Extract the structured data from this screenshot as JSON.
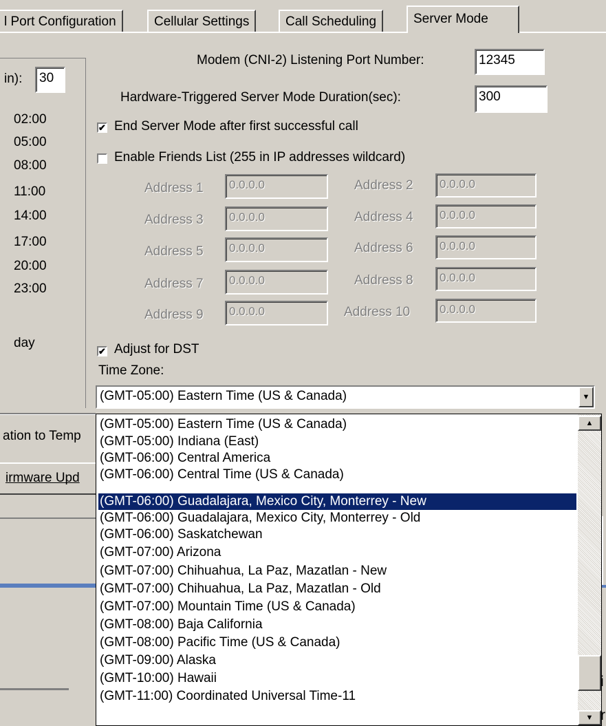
{
  "tabs": [
    {
      "label": "l Port Configuration"
    },
    {
      "label": "Cellular Settings"
    },
    {
      "label": "Call Scheduling"
    },
    {
      "label": "Server Mode"
    }
  ],
  "left_panel": {
    "interval_label": "in):",
    "interval_value": "30",
    "times": [
      "02:00",
      "05:00",
      "08:00",
      "11:00",
      "14:00",
      "17:00",
      "20:00",
      "23:00"
    ],
    "day_label": "day",
    "bottom_labels": [
      "ation to Temp",
      "irmware Upd"
    ]
  },
  "server_mode": {
    "listening_port_label": "Modem (CNI-2) Listening Port Number:",
    "listening_port_value": "12345",
    "duration_label": "Hardware-Triggered Server Mode Duration(sec):",
    "duration_value": "300",
    "end_after_call_label": "End Server Mode after first successful call",
    "end_after_call_checked": true,
    "friends_list_label": "Enable Friends List (255 in IP addresses wildcard)",
    "friends_list_checked": false,
    "addresses": [
      {
        "label": "Address 1",
        "value": "0.0.0.0"
      },
      {
        "label": "Address 2",
        "value": "0.0.0.0"
      },
      {
        "label": "Address 3",
        "value": "0.0.0.0"
      },
      {
        "label": "Address 4",
        "value": "0.0.0.0"
      },
      {
        "label": "Address 5",
        "value": "0.0.0.0"
      },
      {
        "label": "Address 6",
        "value": "0.0.0.0"
      },
      {
        "label": "Address 7",
        "value": "0.0.0.0"
      },
      {
        "label": "Address 8",
        "value": "0.0.0.0"
      },
      {
        "label": "Address 9",
        "value": "0.0.0.0"
      },
      {
        "label": "Address 10",
        "value": "0.0.0.0"
      }
    ],
    "dst_label": "Adjust for DST",
    "dst_checked": true,
    "timezone_label": "Time Zone:",
    "timezone_selected": "(GMT-05:00) Eastern Time (US & Canada)"
  },
  "timezone_options": [
    "(GMT-05:00) Eastern Time (US & Canada)",
    "(GMT-05:00) Indiana (East)",
    "(GMT-06:00) Central America",
    "(GMT-06:00) Central Time (US & Canada)",
    "(GMT-06:00) Guadalajara, Mexico City, Monterrey - New",
    "(GMT-06:00) Guadalajara, Mexico City, Monterrey - Old",
    "(GMT-06:00) Saskatchewan",
    "(GMT-07:00) Arizona",
    "(GMT-07:00) Chihuahua, La Paz, Mazatlan - New",
    "(GMT-07:00) Chihuahua, La Paz, Mazatlan - Old",
    "(GMT-07:00) Mountain Time (US & Canada)",
    "(GMT-08:00) Baja California",
    "(GMT-08:00) Pacific Time (US & Canada)",
    "(GMT-09:00) Alaska",
    "(GMT-10:00) Hawaii",
    "(GMT-11:00) Coordinated Universal Time-11"
  ],
  "highlighted_option_index": 4,
  "right_edge_fragments": [
    "i",
    "r"
  ],
  "icons": {
    "check": "✔",
    "dropdown_arrow": "▼",
    "scroll_up": "▲",
    "scroll_down": "▼"
  }
}
